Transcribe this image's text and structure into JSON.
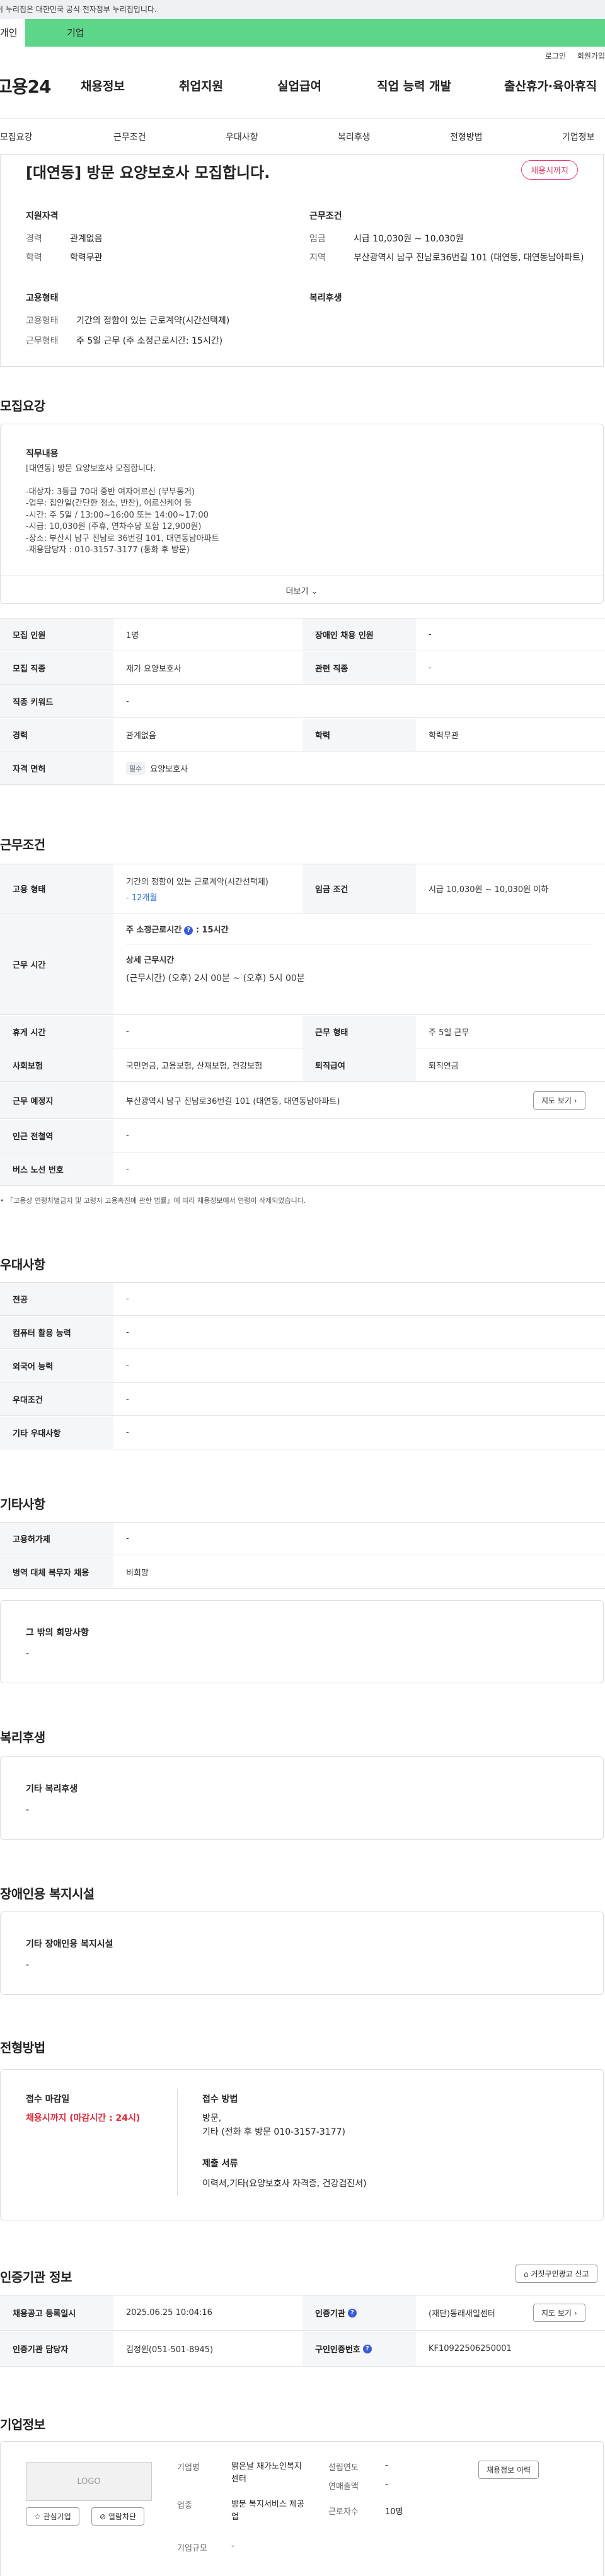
{
  "gov_banner": "이 누리집은 대한민국 공식 전자정부 누리집입니다.",
  "portal_tabs": [
    "개인",
    "기업"
  ],
  "util_links": [
    "로그인",
    "회원가입"
  ],
  "brand": "고용24",
  "gnb": [
    "채용정보",
    "취업지원",
    "실업급여",
    "직업 능력 개발",
    "출산휴가·육아휴직"
  ],
  "subnav": [
    "모집요강",
    "근무조건",
    "우대사항",
    "복리후생",
    "전형방법",
    "기업정보"
  ],
  "header": {
    "title": "[대연동] 방문 요양보호사 모집합니다.",
    "badge": "채용시까지",
    "qual_title": "지원자격",
    "qual": [
      {
        "k": "경력",
        "v": "관계없음"
      },
      {
        "k": "학력",
        "v": "학력무관"
      }
    ],
    "cond_title": "근무조건",
    "cond": [
      {
        "k": "임금",
        "v": "시급 10,030원 ~ 10,030원"
      },
      {
        "k": "지역",
        "v": "부산광역시 남구 진남로36번길 101 (대연동, 대연동남아파트)"
      }
    ],
    "emp_title": "고용형태",
    "emp": [
      {
        "k": "고용형태",
        "v": "기간의 정함이 있는 근로계약(시간선택제)"
      },
      {
        "k": "근무형태",
        "v": "주 5일 근무 (주 소정근로시간: 15시간)"
      }
    ],
    "welfare_title": "복리후생"
  },
  "recruit": {
    "title": "모집요강",
    "duty_label": "직무내용",
    "duty_lines": [
      "[대연동] 방문 요양보호사 모집합니다.",
      "",
      "-대상자: 3등급 70대 중반 여자어르신 (부부동거)",
      "-업무: 집안일(간단한 청소, 반찬), 어르신케어 등",
      "-시간: 주 5일 / 13:00~16:00 또는 14:00~17:00",
      "-시급: 10,030원 (주휴, 연차수당 포함 12,900원)",
      "-장소: 부산시 남구 진남로 36번길 101, 대연동남아파트",
      "-채용담당자 : 010-3157-3177 (통화 후 방문)"
    ],
    "more": "더보기",
    "rows": [
      {
        "k1": "모집 인원",
        "v1": "1명",
        "k2": "장애인 채용 인원",
        "v2": "-"
      },
      {
        "k1": "모집 직종",
        "v1": "재가 요양보호사",
        "k2": "관련 직종",
        "v2": "-"
      },
      {
        "k1": "직종 키워드",
        "v1": "-"
      },
      {
        "k1": "경력",
        "v1": "관계없음",
        "k2": "학력",
        "v2": "학력무관"
      }
    ],
    "license_label": "자격 면허",
    "license_tag": "필수",
    "license_value": "요양보호사"
  },
  "work": {
    "title": "근무조건",
    "emp_label": "고용 형태",
    "emp_value": "기간의 정함이 있는 근로계약(시간선택제)",
    "emp_period": "- 12개월",
    "wage_label": "임금 조건",
    "wage_value": "시급 10,030원 ~ 10,030원 이하",
    "hours_label": "근무 시간",
    "hours_weekly": "주 소정근로시간",
    "hours_weekly_value": "15시간",
    "hours_detail_title": "상세 근무시간",
    "hours_detail": "(근무시간) (오후) 2시 00분 ~ (오후) 5시 00분",
    "rest_label": "휴게 시간",
    "rest_value": "-",
    "form_label": "근무 형태",
    "form_value": "주 5일 근무",
    "ins_label": "사회보험",
    "ins_value": "국민연금, 고용보험, 산재보험, 건강보험",
    "sev_label": "퇴직급여",
    "sev_value": "퇴직연금",
    "place_label": "근무 예정지",
    "place_value": "부산광역시 남구 진남로36번길 101 (대연동, 대연동남아파트)",
    "map_btn": "지도 보기",
    "subway_label": "인근 전철역",
    "subway_value": "-",
    "bus_label": "버스 노선 번호",
    "bus_value": "-",
    "notice": "「고용상 연령차별금지 및 고령자 고용촉진에 관한 법률」에 따라 채용정보에서 연령이 삭제되었습니다."
  },
  "pref": {
    "title": "우대사항",
    "rows": [
      {
        "k": "전공",
        "v": "-"
      },
      {
        "k": "컴퓨터 활용 능력",
        "v": "-"
      },
      {
        "k": "외국어 능력",
        "v": "-"
      },
      {
        "k": "우대조건",
        "v": "-"
      },
      {
        "k": "기타 우대사항",
        "v": "-"
      }
    ]
  },
  "other": {
    "title": "기타사항",
    "rows": [
      {
        "k": "고용허가제",
        "v": "-"
      },
      {
        "k": "병역 대체 복무자 채용",
        "v": "비희망"
      }
    ],
    "etc_label": "그 밖의 희망사항",
    "etc_value": "-"
  },
  "welfare": {
    "title": "복리후생",
    "label": "기타 복리후생",
    "value": "-"
  },
  "disab": {
    "title": "장애인용 복지시설",
    "label": "기타 장애인용 복지시설",
    "value": "-"
  },
  "selection": {
    "title": "전형방법",
    "deadline_label": "접수 마감일",
    "deadline_value": "채용시까지 (마감시간 : 24시)",
    "method_label": "접수 방법",
    "method_lines": [
      "방문,",
      "기타 (전화 후 방문 010-3157-3177)"
    ],
    "docs_label": "제출 서류",
    "docs_value": "이력서,기타(요양보호사 자격증, 건강검진서)"
  },
  "agency": {
    "title": "인증기관 정보",
    "report_btn": "거짓구인광고 신고",
    "reg_label": "채용공고 등록일시",
    "reg_value": "2025.06.25 10:04:16",
    "org_label": "인증기관",
    "org_value": "(재단)동래새일센터",
    "map_btn": "지도 보기",
    "mgr_label": "인증기관 담당자",
    "mgr_value": "김정원(051-501-8945)",
    "code_label": "구인인증번호",
    "code_value": "KF10922506250001"
  },
  "company": {
    "title": "기업정보",
    "logo": "LOGO",
    "fav_btn": "관심기업",
    "block_btn": "열람차단",
    "hire_btn": "채용정보 이력",
    "name_label": "기업명",
    "name_value": "맑은날 재가노인복지센터",
    "found_label": "설립연도",
    "found_value": "-",
    "sales_label": "연매출액",
    "sales_value": "-",
    "ind_label": "업종",
    "ind_value": "방문 복지서비스 제공업",
    "emp_label": "근로자수",
    "emp_value": "10명",
    "scale_label": "기업규모",
    "scale_value": "-"
  }
}
